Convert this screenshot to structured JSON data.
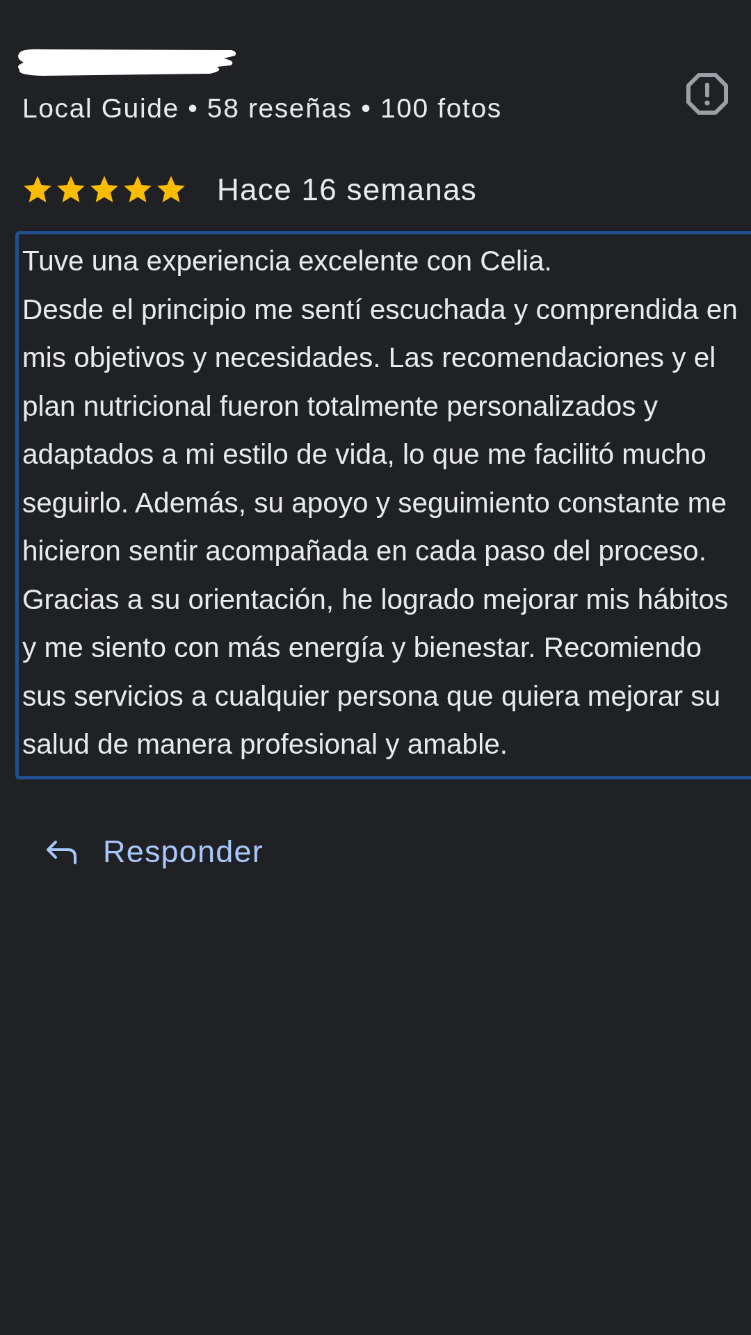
{
  "reviewer": {
    "meta": "Local Guide • 58 reseñas • 100 fotos"
  },
  "review": {
    "stars": 5,
    "time": "Hace 16 semanas",
    "text": "Tuve una experiencia excelente con Celia.\nDesde el principio me sentí escuchada y comprendida en mis objetivos y necesidades. Las recomendaciones y el plan nutricional fueron totalmente personalizados y adaptados a mi estilo de vida, lo que me facilitó mucho seguirlo. Además, su apoyo y seguimiento constante me hicieron sentir acompañada en cada paso del proceso. Gracias a su orientación, he logrado mejorar mis hábitos y me siento con más energía y bienestar. Recomiendo sus servicios a cualquier persona que quiera mejorar su salud de manera profesional y amable.",
    "highlighted": true
  },
  "reply_button": {
    "label": "Responder"
  }
}
